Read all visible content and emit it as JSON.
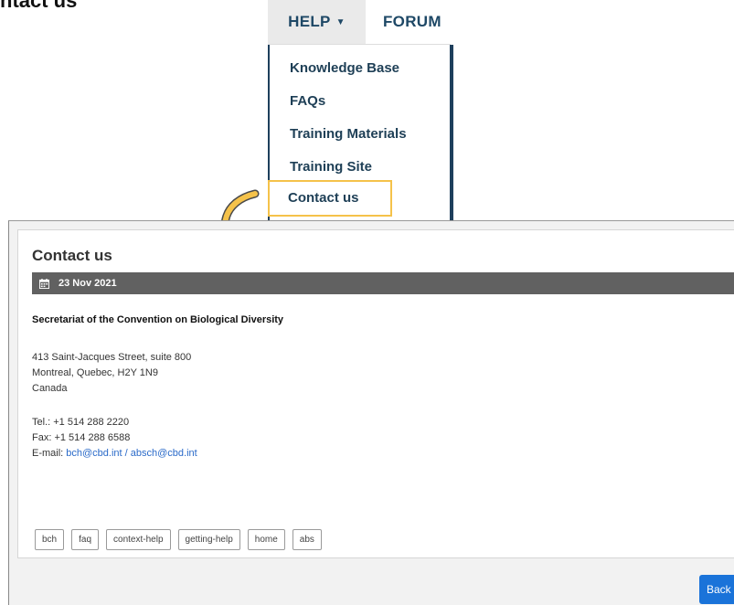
{
  "page_heading": "ntact us",
  "nav": {
    "help_label": "HELP",
    "forum_label": "FORUM",
    "menu_items": [
      "Knowledge Base",
      "FAQs",
      "Training Materials",
      "Training Site"
    ],
    "highlighted_item": "Contact us"
  },
  "contact": {
    "title": "Contact us",
    "date": "23 Nov 2021",
    "org": "Secretariat of the Convention on Biological Diversity",
    "address": [
      "413 Saint-Jacques Street, suite 800",
      "Montreal, Quebec, H2Y 1N9",
      "Canada"
    ],
    "tel": "Tel.: +1 514 288 2220",
    "fax": "Fax: +1 514 288 6588",
    "email_label": "E-mail: ",
    "email_1": "bch@cbd.int",
    "email_sep": " / ",
    "email_2": "absch@cbd.int",
    "tags": [
      "bch",
      "faq",
      "context-help",
      "getting-help",
      "home",
      "abs"
    ]
  },
  "back_label": "Back",
  "colors": {
    "highlight": "#f5c24a",
    "link": "#2a6ac9",
    "date_bar": "#616161",
    "button": "#1a73d9",
    "nav_text": "#1e4866"
  }
}
